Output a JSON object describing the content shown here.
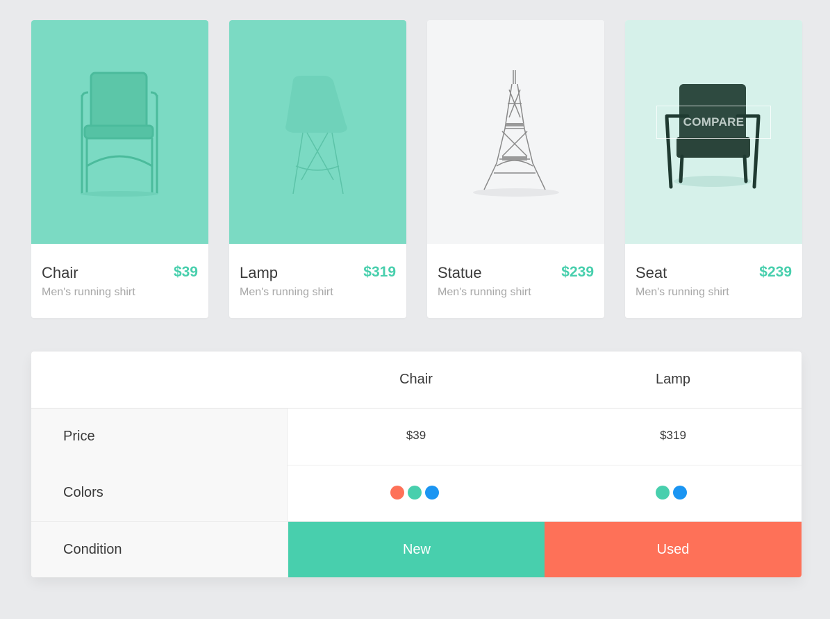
{
  "cards": [
    {
      "name": "Chair",
      "price": "$39",
      "subtitle": "Men's running shirt",
      "bg": "#7bdac3"
    },
    {
      "name": "Lamp",
      "price": "$319",
      "subtitle": "Men's running shirt",
      "bg": "#7bdac3"
    },
    {
      "name": "Statue",
      "price": "$239",
      "subtitle": "Men's running shirt",
      "bg": "#f4f5f6"
    },
    {
      "name": "Seat",
      "price": "$239",
      "subtitle": "Men's running shirt",
      "bg": "#d6f1ea",
      "overlay": "COMPARE"
    }
  ],
  "comparison": {
    "columns": [
      "Chair",
      "Lamp"
    ],
    "rows": {
      "price": {
        "label": "Price",
        "values": [
          "$39",
          "$319"
        ]
      },
      "colors": {
        "label": "Colors",
        "values": [
          [
            "#fe7158",
            "#48cfad",
            "#1b95f2"
          ],
          [
            "#48cfad",
            "#1b95f2"
          ]
        ]
      },
      "condition": {
        "label": "Condition",
        "values": [
          "New",
          "Used"
        ],
        "colors": [
          "#48cfad",
          "#fe7158"
        ]
      }
    }
  },
  "accent": "#48cfad"
}
